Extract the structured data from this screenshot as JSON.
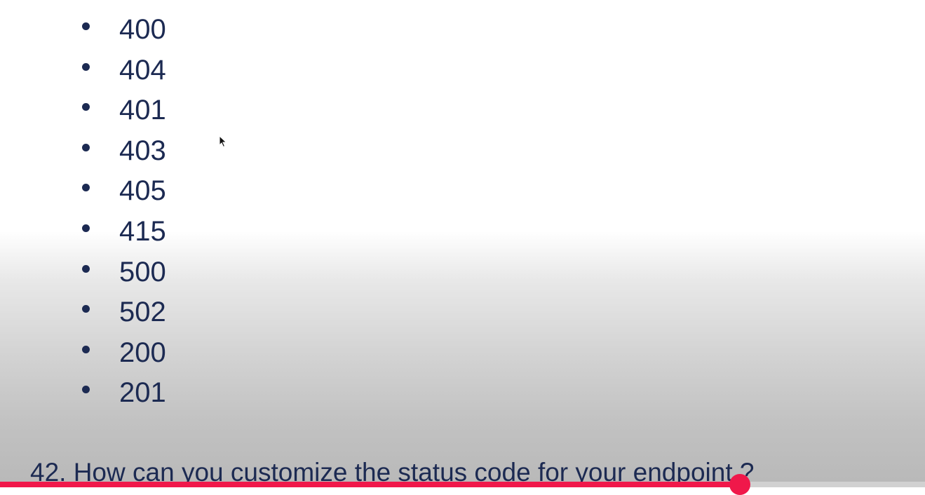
{
  "slide": {
    "status_codes": [
      "400",
      "404",
      "401",
      "403",
      "405",
      "415",
      "500",
      "502",
      "200",
      "201"
    ],
    "question": "42. How can you customize the status code for your endpoint ?"
  },
  "player": {
    "progress_fraction": 0.8,
    "progress_color": "#f0184a"
  },
  "icons": {
    "cursor": "mouse-pointer-icon",
    "bullet": "bullet-icon"
  }
}
